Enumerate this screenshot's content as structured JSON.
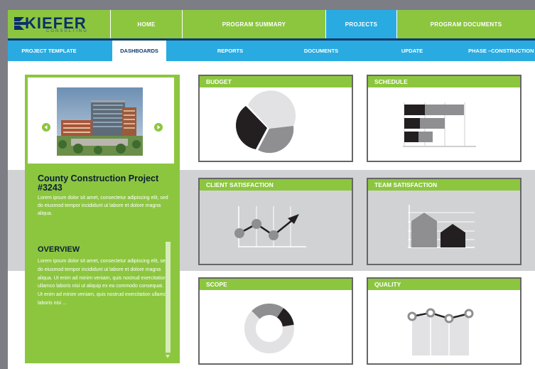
{
  "brand": {
    "name": "KIEFER",
    "subtitle": "CONSULTING",
    "colors": {
      "green": "#8cc63f",
      "blue": "#29abe2",
      "navy": "#0e3a6e",
      "gray": "#d1d2d4"
    }
  },
  "nav": {
    "tabs": [
      {
        "label": "HOME",
        "active": false
      },
      {
        "label": "PROGRAM SUMMARY",
        "active": false
      },
      {
        "label": "PROJECTS",
        "active": true
      },
      {
        "label": "PROGRAM DOCUMENTS",
        "active": false
      }
    ]
  },
  "subnav": {
    "tabs": [
      {
        "label": "PROJECT TEMPLATE",
        "active": false
      },
      {
        "label": "DASHBOARDS",
        "active": true
      },
      {
        "label": "REPORTS",
        "active": false
      },
      {
        "label": "DOCUMENTS",
        "active": false
      },
      {
        "label": "UPDATE",
        "active": false
      },
      {
        "label": "PHASE –CONSTRUCTION",
        "active": false
      }
    ]
  },
  "project": {
    "title": "County Construction Project #3243",
    "description": "Lorem ipsum dolor sit amet, consectetur adipiscing elit, sed do eiusmod tempor incididunt ut labore et dolore magna aliqua.",
    "photo_icon": "building-photo",
    "prev_icon": "arrow-left-icon",
    "next_icon": "arrow-right-icon"
  },
  "overview": {
    "title": "OVERVIEW",
    "text": "Lorem ipsum dolor sit amet, consectetur adipiscing elit, sed do eiusmod tempor incididunt ut labore et dolore magna aliqua. Ut enim ad minim veniam, quis nostrud exercitation ullamco laboris nisi ut aliquip ex ea commodo consequat. Ut enim ad minim veniam, quis nostrud exercitation ullamco laboris nisi ..."
  },
  "cards": {
    "budget": {
      "title": "BUDGET",
      "icon": "pie-chart-icon"
    },
    "schedule": {
      "title": "SCHEDULE",
      "icon": "bar-chart-icon"
    },
    "client_satisfaction": {
      "title": "CLIENT SATISFACTION",
      "icon": "line-chart-icon"
    },
    "team_satisfaction": {
      "title": "TEAM SATISFACTION",
      "icon": "area-chart-icon"
    },
    "scope": {
      "title": "SCOPE",
      "icon": "donut-chart-icon"
    },
    "quality": {
      "title": "QUALITY",
      "icon": "line-chart-icon"
    }
  }
}
